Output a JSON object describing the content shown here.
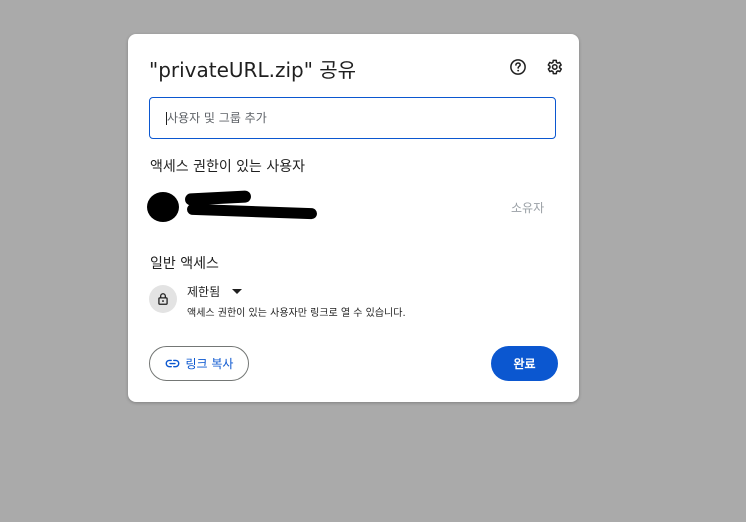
{
  "dialog": {
    "title": "\"privateURL.zip\" 공유",
    "help_icon": "help-circle-icon",
    "settings_icon": "gear-icon"
  },
  "add_people": {
    "placeholder": "사용자 및 그룹 추가"
  },
  "people_with_access": {
    "label": "액세스 권한이 있는 사용자",
    "people": [
      {
        "name": "",
        "role": "소유자"
      }
    ]
  },
  "general_access": {
    "label": "일반 액세스",
    "icon": "lock-icon",
    "value": "제한됨",
    "description": "액세스 권한이 있는 사용자만 링크로 열 수 있습니다."
  },
  "footer": {
    "copy_link_label": "링크 복사",
    "copy_link_icon": "link-icon",
    "done_label": "완료"
  },
  "colors": {
    "overlay": "#aaaaaa",
    "accent": "#0b57d0",
    "muted_text": "#9aa0a6"
  }
}
